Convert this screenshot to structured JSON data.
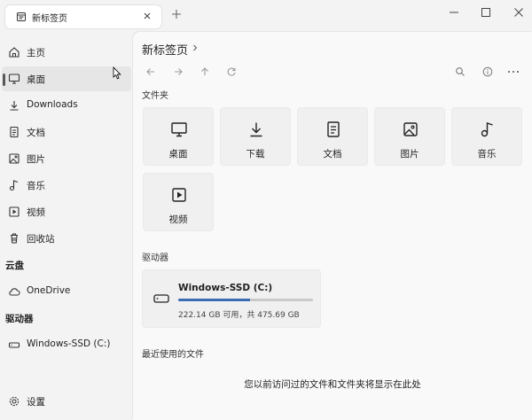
{
  "tab": {
    "title": "新标签页"
  },
  "sidebar": {
    "items": [
      {
        "label": "主页",
        "icon": "home-icon"
      },
      {
        "label": "桌面",
        "icon": "desktop-icon"
      },
      {
        "label": "Downloads",
        "icon": "download-icon"
      },
      {
        "label": "文档",
        "icon": "document-icon"
      },
      {
        "label": "图片",
        "icon": "picture-icon"
      },
      {
        "label": "音乐",
        "icon": "music-icon"
      },
      {
        "label": "视频",
        "icon": "video-icon"
      },
      {
        "label": "回收站",
        "icon": "recycle-bin-icon"
      }
    ],
    "cloud_title": "云盘",
    "cloud_items": [
      {
        "label": "OneDrive",
        "icon": "cloud-icon"
      }
    ],
    "drives_title": "驱动器",
    "drive_items": [
      {
        "label": "Windows-SSD (C:)",
        "icon": "drive-icon"
      }
    ],
    "settings_label": "设置"
  },
  "main": {
    "breadcrumb": "新标签页",
    "folders_title": "文件夹",
    "folders": [
      {
        "label": "桌面",
        "icon": "desktop-icon"
      },
      {
        "label": "下载",
        "icon": "download-icon"
      },
      {
        "label": "文档",
        "icon": "document-icon"
      },
      {
        "label": "图片",
        "icon": "picture-icon"
      },
      {
        "label": "音乐",
        "icon": "music-icon"
      },
      {
        "label": "视频",
        "icon": "video-icon"
      }
    ],
    "drives_title": "驱动器",
    "drive": {
      "name": "Windows-SSD (C:)",
      "size_text": "222.14 GB 可用，共 475.69 GB",
      "used_fraction": 0.53
    },
    "recent_title": "最近使用的文件",
    "recent_empty": "您以前访问过的文件和文件夹将显示在此处"
  },
  "colors": {
    "accent": "#3c6cb4",
    "selected_bg": "#e6e6e6"
  }
}
